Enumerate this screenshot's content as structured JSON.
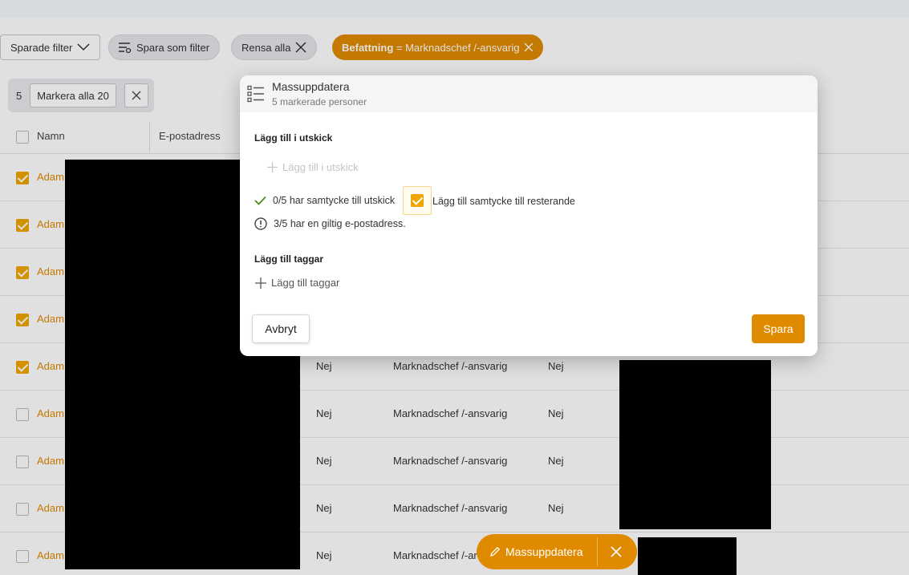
{
  "filters": {
    "saved_filters": "Sparade filter",
    "save_as_filter": "Spara som filter",
    "clear_all": "Rensa alla",
    "active_filter_key": "Befattning",
    "active_filter_value": " = Marknadschef /-ansvarig"
  },
  "selection": {
    "count": "5",
    "select_all": "Markera alla 20"
  },
  "table": {
    "headers": [
      "Namn",
      "E-postadress"
    ],
    "rows": [
      {
        "name": "Adam",
        "checked": true,
        "c1": "",
        "c2": "",
        "c3": ""
      },
      {
        "name": "Adam",
        "checked": true,
        "c1": "",
        "c2": "",
        "c3": ""
      },
      {
        "name": "Adam",
        "checked": true,
        "c1": "",
        "c2": "",
        "c3": ""
      },
      {
        "name": "Adam",
        "checked": true,
        "c1": "",
        "c2": "",
        "c3": ""
      },
      {
        "name": "Adam",
        "checked": true,
        "c1": "Nej",
        "c2": "Marknadschef /-ansvarig",
        "c3": "Nej"
      },
      {
        "name": "Adam",
        "checked": false,
        "c1": "Nej",
        "c2": "Marknadschef /-ansvarig",
        "c3": "Nej"
      },
      {
        "name": "Adam",
        "checked": false,
        "c1": "Nej",
        "c2": "Marknadschef /-ansvarig",
        "c3": "Nej"
      },
      {
        "name": "Adam",
        "checked": false,
        "c1": "Nej",
        "c2": "Marknadschef /-ansvarig",
        "c3": "Nej"
      },
      {
        "name": "Adam",
        "checked": false,
        "c1": "Nej",
        "c2": "Marknadschef /-ar",
        "c3": ""
      }
    ]
  },
  "fab": {
    "label": "Massuppdatera"
  },
  "modal": {
    "title": "Massuppdatera",
    "subtitle": "5 markerade personer",
    "section_mailing": "Lägg till i utskick",
    "add_mailing": "Lägg till i utskick",
    "consent_status": "0/5 har samtycke till utskick",
    "consent_label": "Lägg till samtycke till resterande",
    "email_status": "3/5 har en giltig e-postadress.",
    "section_tags": "Lägg till taggar",
    "add_tags": "Lägg till taggar",
    "cancel": "Avbryt",
    "save": "Spara"
  },
  "colors": {
    "accent": "#e08a00",
    "checkbox": "#f0a500",
    "success": "#4a8a1c"
  }
}
